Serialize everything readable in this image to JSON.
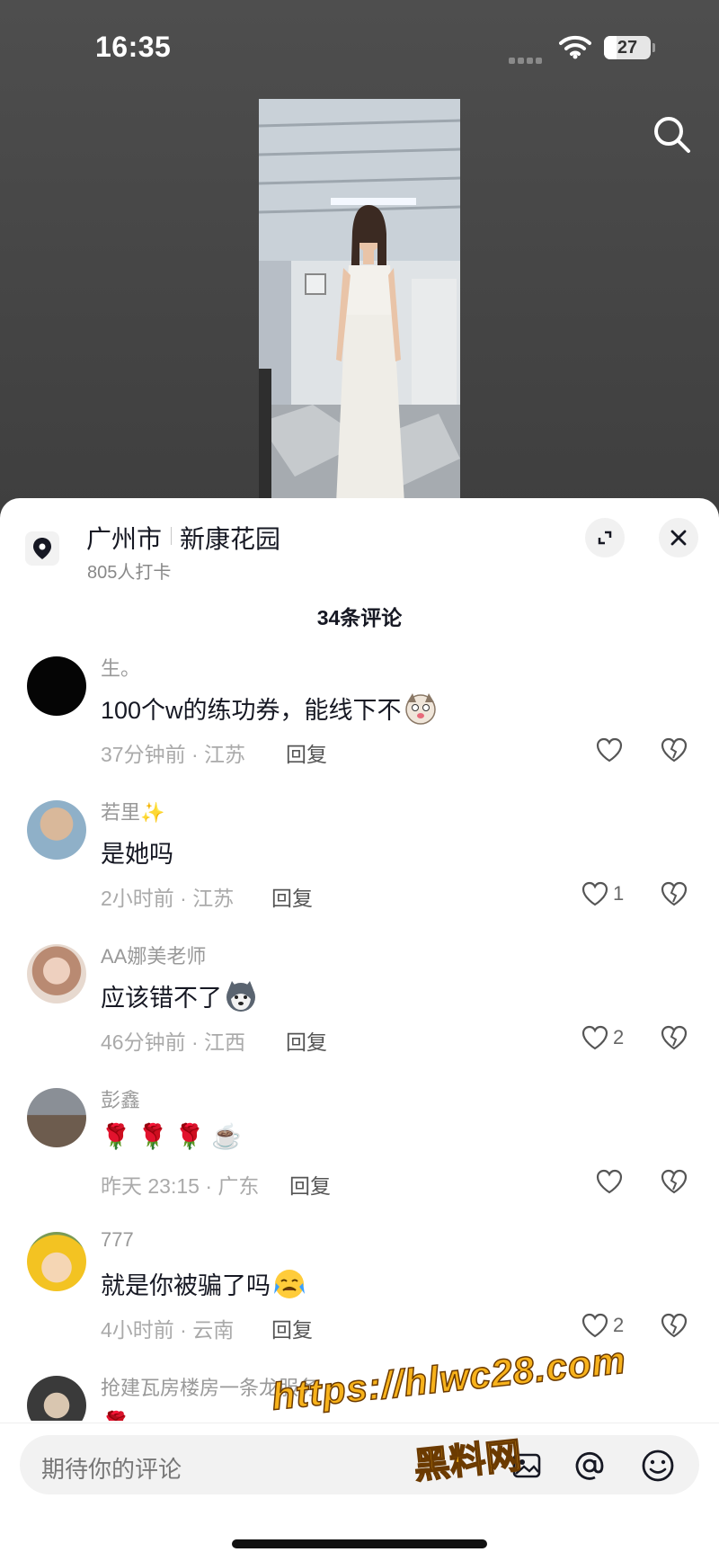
{
  "status_bar": {
    "time": "16:35",
    "battery": "27",
    "battery_level": 0.27
  },
  "location": {
    "city": "广州市",
    "place": "新康花园",
    "checkins": "805人打卡"
  },
  "comments_header": "34条评论",
  "comments": [
    {
      "name": "生。",
      "text": "100个w的练功券，能线下不",
      "emoji": "dog-face",
      "time": "37分钟前 · 江苏",
      "reply": "回复",
      "likes": ""
    },
    {
      "name": "若里✨",
      "text": "是她吗",
      "emoji": "",
      "time": "2小时前 · 江苏",
      "reply": "回复",
      "likes": "1"
    },
    {
      "name": "AA娜美老师",
      "text": "应该错不了",
      "emoji": "husky-face",
      "time": "46分钟前 · 江西",
      "reply": "回复",
      "likes": "2"
    },
    {
      "name": "彭鑫",
      "text": "🌹 🌹 🌹 ☕",
      "emoji": "",
      "time": "昨天 23:15 · 广东",
      "reply": "回复",
      "likes": ""
    },
    {
      "name": "777",
      "text": "就是你被骗了吗",
      "emoji": "crying-face",
      "time": "4小时前 · 云南",
      "reply": "回复",
      "likes": "2"
    },
    {
      "name": "抢建瓦房楼房一条龙服务",
      "text": "🌹",
      "emoji": "",
      "time": "",
      "reply": "",
      "likes": ""
    }
  ],
  "input": {
    "placeholder": "期待你的评论"
  },
  "watermark": {
    "line1": "https://hlwc28.com",
    "line2": "黑料网"
  },
  "colors": {
    "text": "#161823",
    "secondary": "#999999",
    "bg_dark": "#4a4a4a"
  },
  "icons": [
    "search-icon",
    "location-pin-icon",
    "expand-icon",
    "close-icon",
    "heart-icon",
    "broken-heart-icon",
    "image-icon",
    "at-icon",
    "emoji-icon"
  ]
}
